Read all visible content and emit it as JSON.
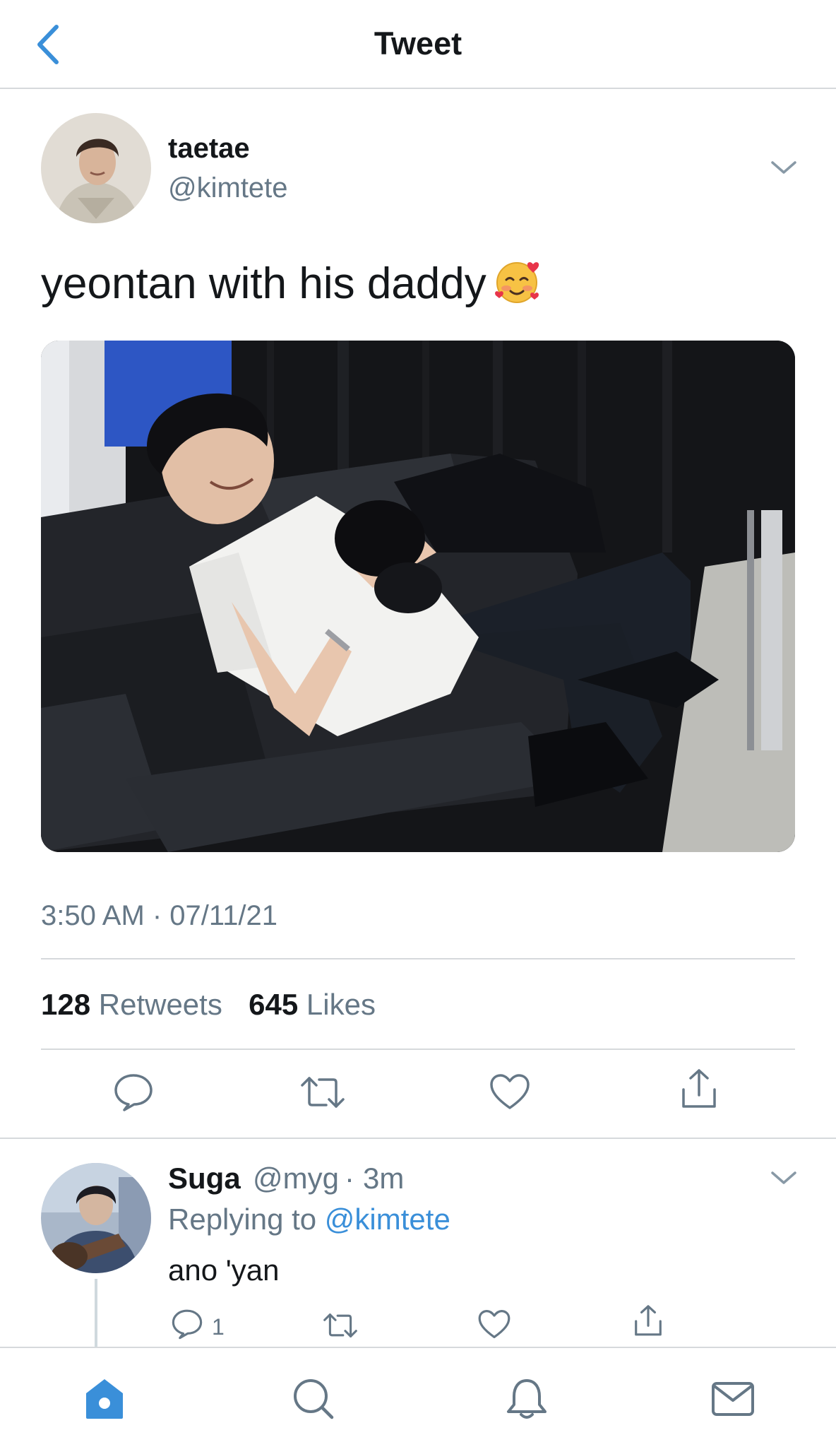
{
  "header": {
    "title": "Tweet"
  },
  "tweet": {
    "author_name": "taetae",
    "author_handle": "@kimtete",
    "text": "yeontan with his daddy",
    "timestamp": "3:50 AM · 07/11/21",
    "retweets_count": "128",
    "retweets_label": "Retweets",
    "likes_count": "645",
    "likes_label": "Likes"
  },
  "reply": {
    "author_name": "Suga",
    "author_handle": "@myg",
    "separator": "·",
    "time_ago": "3m",
    "replying_label": "Replying to",
    "replying_mention": "@kimtete",
    "text": "ano 'yan",
    "reply_count": "1"
  },
  "colors": {
    "accent": "#3a8fd9",
    "text": "#14171a",
    "secondary": "#657786",
    "divider": "#d6d9dc"
  },
  "icons": {
    "back": "chevron-left-icon",
    "more": "chevron-down-icon",
    "reply": "speech-bubble-icon",
    "retweet": "retweet-icon",
    "like": "heart-icon",
    "share": "share-icon",
    "nav": [
      "home-icon",
      "search-icon",
      "bell-icon",
      "mail-icon"
    ]
  }
}
